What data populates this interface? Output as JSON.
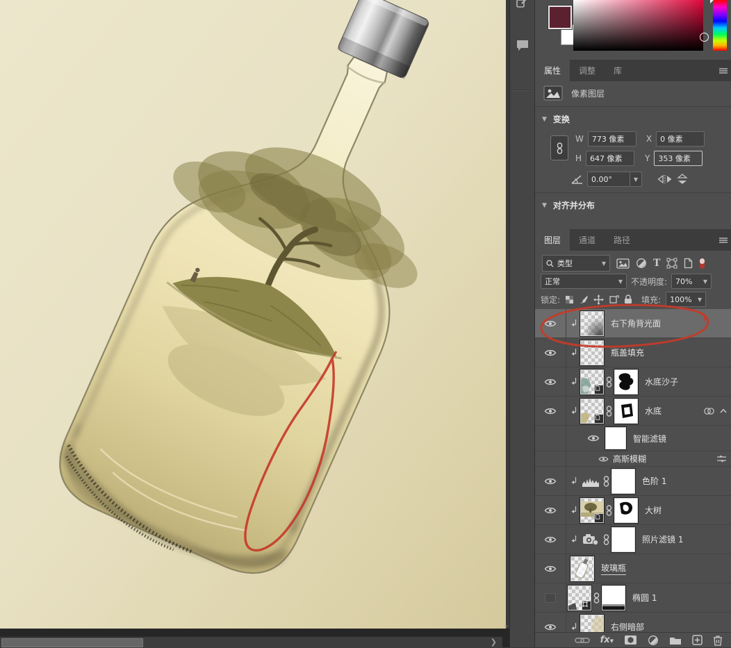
{
  "ui": {
    "panel_bg": "#4e4e4e",
    "selected_row_bg": "#6b6b6b",
    "annotation_red": "#c63b29",
    "canvas_bg": "#e9e2c4",
    "foreground_color": "#5c2130",
    "background_color": "#ffffff"
  },
  "canvas": {
    "artwork": "glass bottle with tree island inside, metal cap, cream background",
    "annotation": "hand-drawn red loop on lower-right edge of bottle"
  },
  "properties_panel": {
    "tabs": [
      {
        "label": "属性"
      },
      {
        "label": "调整"
      },
      {
        "label": "库"
      }
    ],
    "layer_type_label": "像素图层",
    "transform": {
      "section_title": "变换",
      "w_label": "W",
      "w_value": "773 像素",
      "x_label": "X",
      "x_value": "0 像素",
      "h_label": "H",
      "h_value": "647 像素",
      "y_label": "Y",
      "y_value": "353 像素",
      "angle_value": "0.00°"
    },
    "align_section_title": "对齐并分布"
  },
  "layers_panel": {
    "tabs": [
      {
        "label": "图层"
      },
      {
        "label": "通道"
      },
      {
        "label": "路径"
      }
    ],
    "filter_label": "类型",
    "blend_mode": "正常",
    "opacity_label": "不透明度:",
    "opacity_value": "70%",
    "lock_label": "锁定:",
    "fill_label": "填充:",
    "fill_value": "100%",
    "layers": [
      {
        "name": "右下角背光面",
        "visible": true,
        "clipped": true,
        "selected": true
      },
      {
        "name": "瓶盖填充",
        "visible": true,
        "clipped": true
      },
      {
        "name": "水底沙子",
        "visible": true,
        "clipped": true,
        "smart_object": true,
        "mask": true
      },
      {
        "name": "水底",
        "visible": true,
        "clipped": true,
        "smart_object": true,
        "mask": true,
        "smart_filters": true
      },
      {
        "name": "智能滤镜",
        "visible": true,
        "type": "smart-filters-header"
      },
      {
        "name": "高斯模糊",
        "visible": true,
        "type": "smart-filter-item"
      },
      {
        "name": "色阶 1",
        "visible": true,
        "clipped": true,
        "adjustment": "levels",
        "mask": true
      },
      {
        "name": "大树",
        "visible": true,
        "clipped": true,
        "smart_object": true,
        "mask": true
      },
      {
        "name": "照片滤镜 1",
        "visible": true,
        "clipped": true,
        "adjustment": "photo-filter",
        "mask": true
      },
      {
        "name": "玻璃瓶",
        "visible": true
      },
      {
        "name": "椭圆 1",
        "visible": false,
        "shape": true,
        "mask": true
      },
      {
        "name": "右侧暗部",
        "visible": true,
        "clipped": true
      }
    ]
  }
}
